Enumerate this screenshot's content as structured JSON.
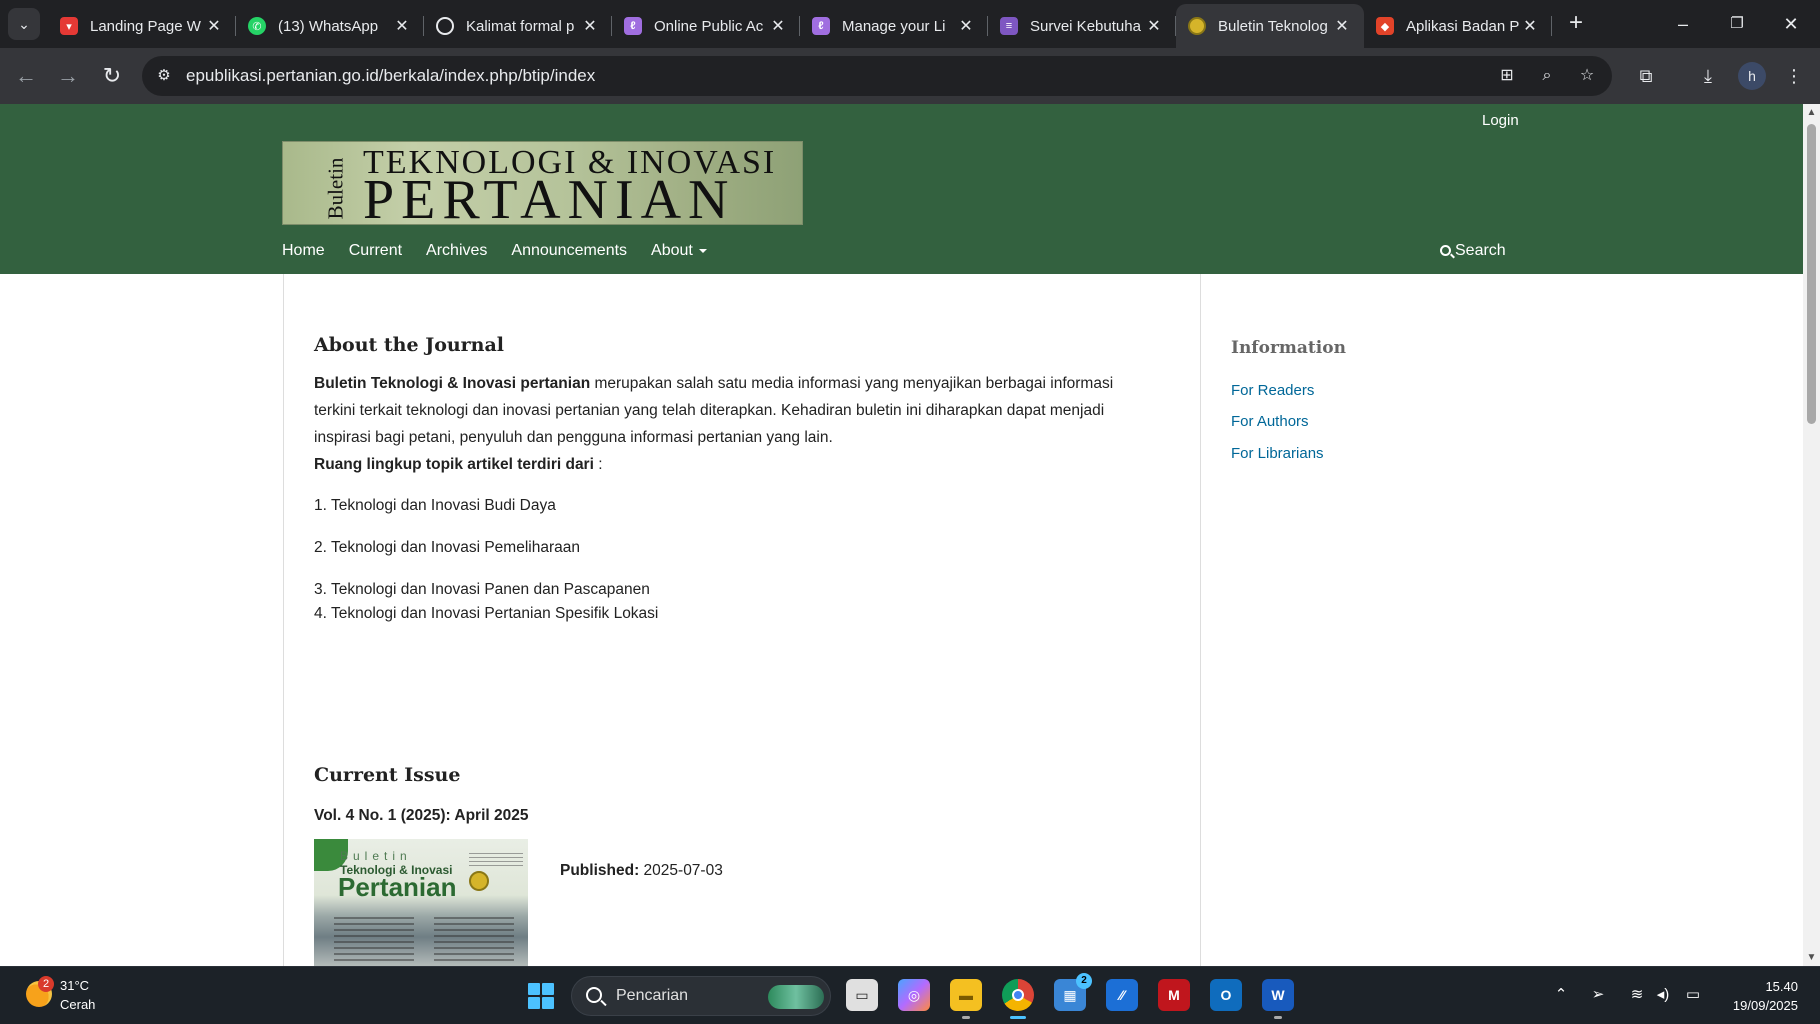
{
  "browser": {
    "tabs": [
      {
        "title": "Landing Page W",
        "icon": "gift-red-icon",
        "color": "#e53935"
      },
      {
        "title": "(13) WhatsApp",
        "icon": "whatsapp-icon",
        "color": "#25d366"
      },
      {
        "title": "Kalimat formal p",
        "icon": "openai-icon",
        "color": "#e8eaed"
      },
      {
        "title": "Online Public Ac",
        "icon": "purple-link-icon",
        "color": "#a06ee0"
      },
      {
        "title": "Manage your Li",
        "icon": "purple-link-icon",
        "color": "#a06ee0"
      },
      {
        "title": "Survei Kebutuha",
        "icon": "forms-icon",
        "color": "#7e57c2"
      },
      {
        "title": "Buletin Teknolog",
        "icon": "ministry-seal-icon",
        "color": "#d5b42a"
      },
      {
        "title": "Aplikasi Badan P",
        "icon": "gitlab-icon",
        "color": "#e24329"
      }
    ],
    "active_tab_index": 6,
    "url": "epublikasi.pertanian.go.id/berkala/index.php/btip/index",
    "profile_initial": "h"
  },
  "site": {
    "login": "Login",
    "logo": {
      "vertical": "Buletin",
      "line1": "TEKNOLOGI & INOVASI",
      "line2": "PERTANIAN"
    },
    "nav": [
      "Home",
      "Current",
      "Archives",
      "Announcements",
      "About"
    ],
    "search": "Search"
  },
  "main": {
    "about_heading": "About the Journal",
    "about_bold": "Buletin Teknologi & Inovasi pertanian",
    "about_text": " merupakan salah satu media informasi yang menyajikan berbagai informasi terkini terkait teknologi dan inovasi pertanian yang telah diterapkan. Kehadiran buletin ini diharapkan dapat menjadi inspirasi bagi petani, penyuluh dan pengguna informasi pertanian yang lain.",
    "scope_heading": "Ruang lingkup topik artikel terdiri dari",
    "scope_colon": " :",
    "scope_items": [
      "1. Teknologi dan Inovasi Budi Daya",
      "2. Teknologi dan Inovasi Pemeliharaan",
      "3. Teknologi dan Inovasi Panen dan Pascapanen",
      "4.  Teknologi dan Inovasi Pertanian Spesifik Lokasi"
    ],
    "current_heading": "Current Issue",
    "issue_title": "Vol. 4 No. 1 (2025): April 2025",
    "cover": {
      "line1": "Buletin",
      "line2": "Teknologi & Inovasi",
      "line3": "Pertanian"
    },
    "published_label": "Published:",
    "published_date": "2025-07-03"
  },
  "sidebar": {
    "heading": "Information",
    "links": [
      "For Readers",
      "For Authors",
      "For Librarians"
    ]
  },
  "taskbar": {
    "weather_temp": "31°C",
    "weather_desc": "Cerah",
    "weather_badge": "2",
    "search_placeholder": "Pencarian",
    "store_badge": "2",
    "time": "15.40",
    "date": "19/09/2025"
  }
}
